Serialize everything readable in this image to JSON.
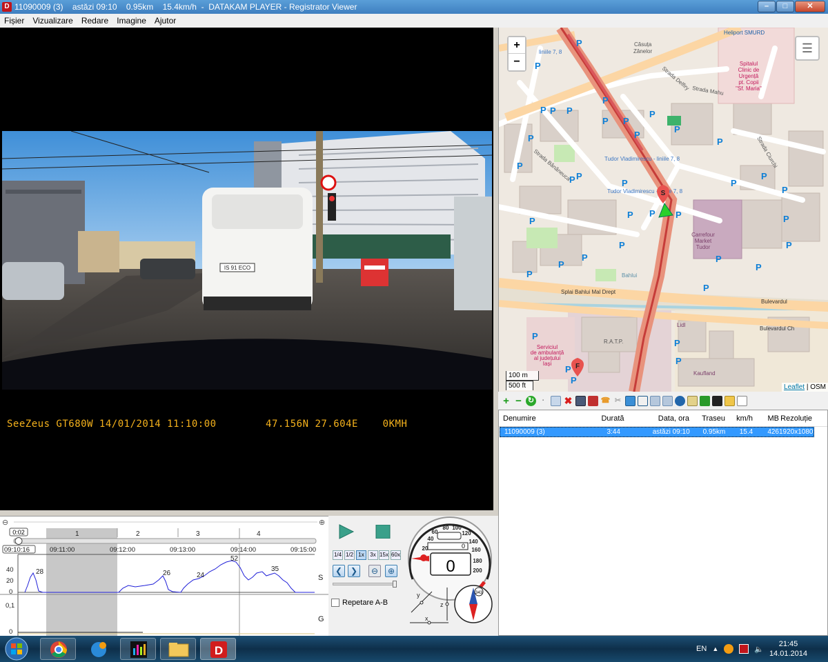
{
  "window": {
    "title": "11090009 (3)    astăzi 09:10    0.95km    15.4km/h  -  DATAKAM PLAYER - Registrator Viewer",
    "minimize": "–",
    "maximize": "□",
    "close": "✕"
  },
  "menu": [
    "Fișier",
    "Vizualizare",
    "Redare",
    "Imagine",
    "Ajutor"
  ],
  "video": {
    "osd_left": "SeeZeus GT680W 14/01/2014 11:10:00",
    "osd_right": "47.156N 27.604E    0KMH",
    "plate": "IS 91 ECO"
  },
  "map": {
    "zoom_in": "+",
    "zoom_out": "−",
    "scale_m": "100 m",
    "scale_ft": "500 ft",
    "attribution_link": "Leaflet",
    "attribution_text": " | OSM",
    "labels": {
      "heliport": "Heliport SMURD",
      "casuta": "Căsuța",
      "zanelor": "Zânelor",
      "hospital1": "Spitalul",
      "hospital2": "Clinic de",
      "hospital3": "Urgență",
      "hospital4": "pt. Copii",
      "hospital5": "\"Sf. Maria\"",
      "str_delfiry": "Strada Delfiry",
      "str_mahu": "Strada Mahu",
      "str_ciurchi": "Strada Ciurchi",
      "str_bang": "Strada Bănăneuca",
      "tudor1": "Tudor Vladimirescu - liniile 7, 8",
      "tudor2": "Tudor Vladimirescu - liniile 7, 8",
      "liniile_top": "liniile 7, 8",
      "carrefour1": "Carrefour",
      "carrefour2": "Market",
      "carrefour3": "Tudor",
      "bahlui": "Bahlui",
      "splai": "Splai Bahlui Mal Drept",
      "bulevardul1": "Bulevardul",
      "bulevardul2": "Bulevardul Ch",
      "lidl": "Lidl",
      "ratp": "R.A.T.P.",
      "kaufland": "Kaufland",
      "serviciul1": "Serviciul",
      "serviciul2": "de ambulanță",
      "serviciul3": "al județului",
      "serviciul4": "Iași",
      "start_marker": "S",
      "finish_marker": "F"
    }
  },
  "filelist": {
    "headers": [
      "Denumire",
      "Durată",
      "Data, ora",
      "Traseu",
      "km/h",
      "MB",
      "Rezoluție"
    ],
    "rows": [
      {
        "name": "11090009 (3)",
        "duration": "3:44",
        "date": "astăzi 09:10",
        "route": "0.95km",
        "speed": "15.4",
        "mb": "426",
        "res": "1920x1080"
      }
    ]
  },
  "timeline": {
    "current": "0:02",
    "start": "09:10:16",
    "segments": [
      "1",
      "2",
      "3",
      "4"
    ],
    "times": [
      "09:11:00",
      "09:12:00",
      "09:13:00",
      "09:14:00",
      "09:15:00"
    ],
    "s_label": "S",
    "g_label": "G",
    "y_ticks": [
      "40",
      "20",
      "0"
    ],
    "g_ticks": [
      "0,1",
      "0"
    ],
    "peaks": [
      "28",
      "26",
      "24",
      "52",
      "35"
    ]
  },
  "controls": {
    "speeds": [
      "1/4",
      "1/2",
      "1x",
      "3x",
      "15x",
      "60x"
    ],
    "repeat": "Repetare A-B"
  },
  "speedometer": {
    "value": "0",
    "odo": "0",
    "ticks": [
      "20",
      "40",
      "60",
      "80",
      "100",
      "120",
      "140",
      "160",
      "180",
      "200"
    ]
  },
  "axes": {
    "x": "x",
    "y": "y",
    "z": "z"
  },
  "compass": {
    "heading": "343"
  },
  "tray": {
    "lang": "EN",
    "time": "21:45",
    "date": "14.01.2014"
  },
  "colors": {
    "titlebar": "#4a8fcf",
    "selection": "#3399ff",
    "osd": "#f5b21c",
    "route": "#e8524f",
    "graph": "#1f1fd8"
  }
}
